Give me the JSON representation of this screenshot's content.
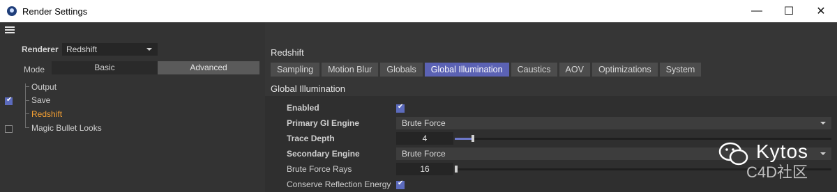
{
  "window": {
    "title": "Render Settings",
    "minimize": "—",
    "maximize": "☐",
    "close": "✕"
  },
  "left": {
    "renderer_label": "Renderer",
    "renderer_value": "Redshift",
    "mode_label": "Mode",
    "mode_basic": "Basic",
    "mode_advanced": "Advanced",
    "tree": [
      {
        "label": "Output",
        "checked": null
      },
      {
        "label": "Save",
        "checked": true
      },
      {
        "label": "Redshift",
        "checked": null,
        "highlight": true
      },
      {
        "label": "Magic Bullet Looks",
        "checked": false
      }
    ]
  },
  "right": {
    "section_title": "Redshift",
    "tabs": [
      "Sampling",
      "Motion Blur",
      "Globals",
      "Global Illumination",
      "Caustics",
      "AOV",
      "Optimizations",
      "System"
    ],
    "active_tab": "Global Illumination",
    "group_title": "Global Illumination",
    "props": {
      "enabled_label": "Enabled",
      "enabled": true,
      "primary_label": "Primary GI Engine",
      "primary_value": "Brute Force",
      "trace_label": "Trace Depth",
      "trace_value": "4",
      "secondary_label": "Secondary Engine",
      "secondary_value": "Brute Force",
      "rays_label": "Brute Force Rays",
      "rays_value": "16",
      "conserve_label": "Conserve Reflection Energy",
      "conserve": true
    }
  },
  "watermark": {
    "main": "Kytos",
    "sub": "C4D社区"
  },
  "colors": {
    "accent": "#5b62b4",
    "highlight": "#f5a033"
  }
}
